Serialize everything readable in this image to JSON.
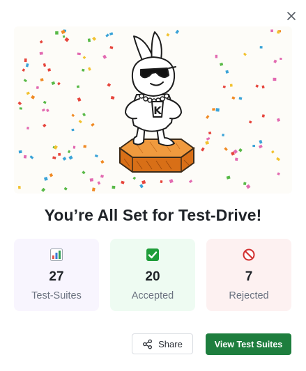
{
  "dialog": {
    "close_icon": "close-icon",
    "title": "You’re All Set for Test-Drive!"
  },
  "hero": {
    "illustration": "mascot-on-pedestal-illustration",
    "badge_letter": "K"
  },
  "stats": [
    {
      "icon": "bar-chart-icon",
      "value": "27",
      "label": "Test-Suites",
      "background": "#f8f5fe"
    },
    {
      "icon": "check-mark-icon",
      "value": "20",
      "label": "Accepted",
      "background": "#eefbf2"
    },
    {
      "icon": "prohibited-icon",
      "value": "7",
      "label": "Rejected",
      "background": "#fdf1f1"
    }
  ],
  "actions": {
    "share_label": "Share",
    "share_icon": "share-icon",
    "view_label": "View Test Suites",
    "view_color": "#1e7e3e"
  }
}
